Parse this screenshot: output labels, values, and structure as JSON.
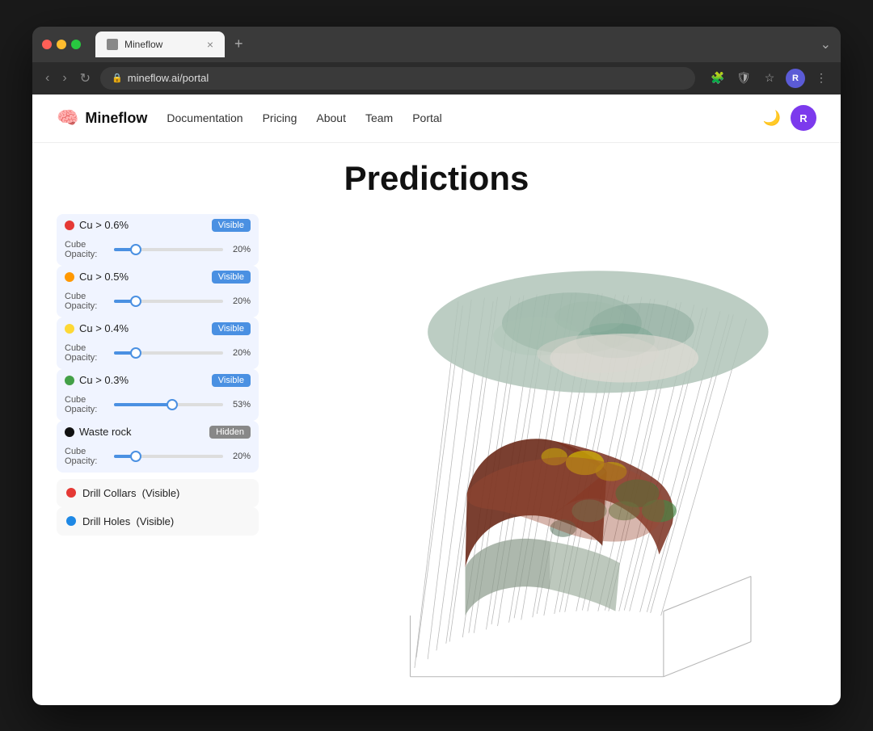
{
  "browser": {
    "tab_title": "Mineflow",
    "url": "mineflow.ai/portal",
    "tab_close": "×",
    "tab_new": "+",
    "nav_back": "‹",
    "nav_forward": "›",
    "nav_refresh": "↻",
    "profile_letter": "R",
    "window_expand": "⌄"
  },
  "header": {
    "logo_text": "Mineflow",
    "nav": [
      {
        "label": "Documentation",
        "key": "documentation"
      },
      {
        "label": "Pricing",
        "key": "pricing"
      },
      {
        "label": "About",
        "key": "about"
      },
      {
        "label": "Team",
        "key": "team"
      },
      {
        "label": "Portal",
        "key": "portal"
      }
    ],
    "theme_icon": "🌙",
    "user_letter": "R"
  },
  "page": {
    "title": "Predictions"
  },
  "layers": [
    {
      "id": "cu06",
      "name": "Cu > 0.6%",
      "dot_color": "#e53935",
      "toggle_label": "Visible",
      "toggle_state": "visible",
      "opacity_label": "Cube\nOpacity:",
      "opacity_pct": 20,
      "fill_pct": 20
    },
    {
      "id": "cu05",
      "name": "Cu > 0.5%",
      "dot_color": "#ff9800",
      "toggle_label": "Visible",
      "toggle_state": "visible",
      "opacity_label": "Cube\nOpacity:",
      "opacity_pct": 20,
      "fill_pct": 20
    },
    {
      "id": "cu04",
      "name": "Cu > 0.4%",
      "dot_color": "#fdd835",
      "toggle_label": "Visible",
      "toggle_state": "visible",
      "opacity_label": "Cube\nOpacity:",
      "opacity_pct": 20,
      "fill_pct": 20
    },
    {
      "id": "cu03",
      "name": "Cu > 0.3%",
      "dot_color": "#43a047",
      "toggle_label": "Visible",
      "toggle_state": "visible",
      "opacity_label": "Cube\nOpacity:",
      "opacity_pct": 53,
      "fill_pct": 53
    },
    {
      "id": "waste",
      "name": "Waste rock",
      "dot_color": "#111",
      "toggle_label": "Hidden",
      "toggle_state": "hidden",
      "opacity_label": "Cube\nOpacity:",
      "opacity_pct": 20,
      "fill_pct": 20
    }
  ],
  "overlays": [
    {
      "id": "drill-collars",
      "name": "Drill Collars",
      "status": "(Visible)",
      "dot_color": "#e53935"
    },
    {
      "id": "drill-holes",
      "name": "Drill Holes",
      "status": "(Visible)",
      "dot_color": "#1e88e5"
    }
  ]
}
